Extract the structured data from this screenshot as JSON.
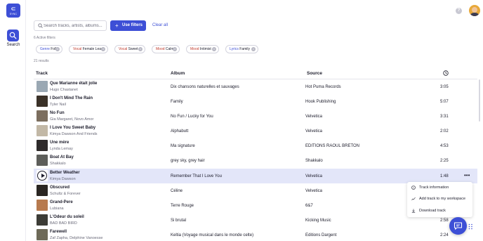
{
  "brand": {
    "logo_text": "SYNC"
  },
  "sidebar": {
    "search_label": "Search"
  },
  "search": {
    "placeholder": "Search tracks, artists, albums...",
    "value": ""
  },
  "toolbar": {
    "use_filters_label": "Use filters",
    "clear_all_label": "Clear all"
  },
  "active_filters_text": "6 Active filters",
  "chips": [
    {
      "category": "Genre",
      "value": "Folk",
      "color": "#3d4fd6"
    },
    {
      "category": "Vocal",
      "value": "Female Lead",
      "color": "#c0392b"
    },
    {
      "category": "Vocal",
      "value": "Sweet",
      "color": "#c0392b"
    },
    {
      "category": "Mood",
      "value": "Calm",
      "color": "#c0392b"
    },
    {
      "category": "Mood",
      "value": "Intimist",
      "color": "#c0392b"
    },
    {
      "category": "Lyrics",
      "value": "Family",
      "color": "#3d4fd6"
    }
  ],
  "results_text": "21 results",
  "table": {
    "headers": {
      "track": "Track",
      "album": "Album",
      "source": "Source"
    },
    "rows": [
      {
        "title": "Que Marianne était jolie",
        "artist": "Hugo Chastanet",
        "album": "Dix chansons naturelles et sauvages",
        "source": "Hot Puma Records",
        "duration": "3:05",
        "thumb": "#9aa8b3"
      },
      {
        "title": "I Don't Mind The Rain",
        "artist": "Tyler Nail",
        "album": "Family",
        "source": "Hook Publishing",
        "duration": "5:07",
        "thumb": "#3b3228"
      },
      {
        "title": "No Fun",
        "artist": "Gia Margaret, Novo Amor",
        "album": "No Fun / Lucky for You",
        "source": "Velvetica",
        "duration": "3:31",
        "thumb": "#7c6e5e"
      },
      {
        "title": "I Love You Sweet Baby",
        "artist": "Kimya Dawson And Friends",
        "album": "Alphabutt",
        "source": "Velvetica",
        "duration": "2:02",
        "thumb": "#c2b8a6"
      },
      {
        "title": "Une mère",
        "artist": "Lynda Lemay",
        "album": "Ma signature",
        "source": "EDITIONS RAOUL BRETON",
        "duration": "4:53",
        "thumb": "#2e2a2a"
      },
      {
        "title": "Boat At Bay",
        "artist": "Shakkalo",
        "album": "grey sky, grey hair",
        "source": "Shakkalo",
        "duration": "2:25",
        "thumb": "#5d5e5a"
      },
      {
        "title": "Better Weather",
        "artist": "Kimya Dawson",
        "album": "Remember That I Love You",
        "source": "Velvetica",
        "duration": "1:48",
        "thumb": "#ffffff",
        "active": true
      },
      {
        "title": "Obscured",
        "artist": "Schultz & Forever",
        "album": "Céline",
        "source": "Velvetica",
        "duration": "",
        "thumb": "#2a2622"
      },
      {
        "title": "Grand-Pere",
        "artist": "Lubiana",
        "album": "Terre Rouge",
        "source": "6&7",
        "duration": "",
        "thumb": "#b77a4e"
      },
      {
        "title": "L'Odeur du soleil",
        "artist": "BAD BAD BIRD",
        "album": "Si brutal",
        "source": "Kicking Music",
        "duration": "2:58",
        "thumb": "#3c3c36"
      },
      {
        "title": "Farewell",
        "artist": "Zaf Zapha, Delphine Vanoesse",
        "album": "Keltia (Voyage musical dans le monde celte)",
        "source": "Editions Dargent",
        "duration": "2:24",
        "thumb": "#6e6a58"
      }
    ]
  },
  "context_menu": {
    "items": [
      {
        "label": "Track information",
        "icon": "info-icon"
      },
      {
        "label": "Add track to my workspace",
        "icon": "add-to-workspace-icon"
      },
      {
        "label": "Download track",
        "icon": "download-icon"
      }
    ]
  },
  "colors": {
    "accent": "#3d4fd6",
    "active_row": "#e3e6f9"
  }
}
